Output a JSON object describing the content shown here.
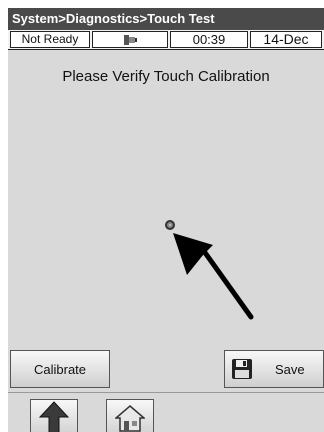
{
  "title_bar": {
    "breadcrumb": "System>Diagnostics>Touch Test"
  },
  "status_bar": {
    "state": "Not Ready",
    "connection_icon": "vci-connector-icon",
    "time": "00:39",
    "date": "14-Dec"
  },
  "main": {
    "instruction": "Please Verify Touch Calibration",
    "target_icon": "touch-target-icon",
    "pointer_icon": "arrow-pointer-icon"
  },
  "buttons": {
    "calibrate_label": "Calibrate",
    "save_label": "Save",
    "save_icon": "floppy-disk-icon"
  },
  "nav": {
    "back_icon": "up-arrow-icon",
    "home_icon": "home-icon"
  }
}
